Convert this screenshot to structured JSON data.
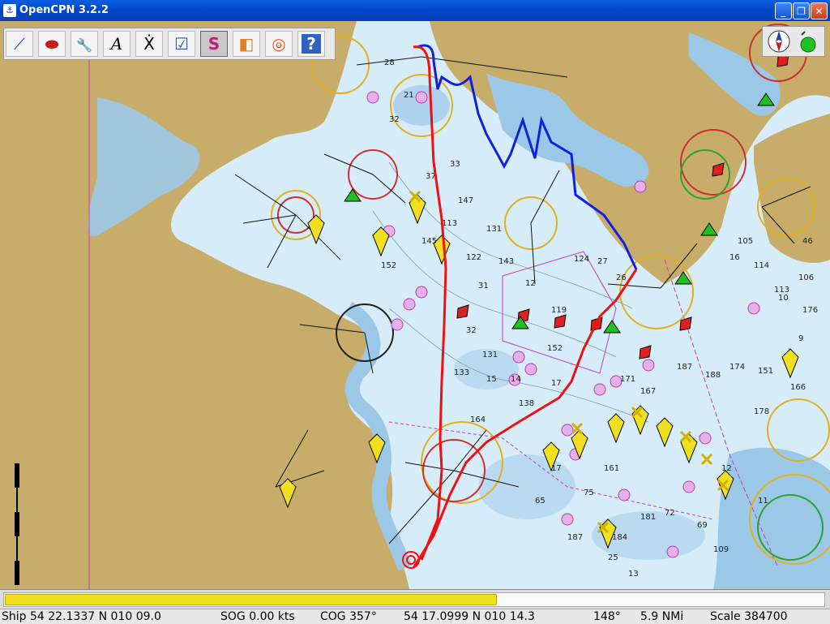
{
  "window": {
    "title": "OpenCPN 3.2.2",
    "minimize": "_",
    "maximize": "❐",
    "close": "✕"
  },
  "toolbar": {
    "tools": [
      {
        "name": "route",
        "icon": "route-icon",
        "glyph": "⟋"
      },
      {
        "name": "ship",
        "icon": "ship-icon",
        "glyph": "⬬"
      },
      {
        "name": "settings",
        "icon": "wrench-icon",
        "glyph": "🔧"
      },
      {
        "name": "text",
        "icon": "text-icon",
        "glyph": "A"
      },
      {
        "name": "hide-text",
        "icon": "hide-text-icon",
        "glyph": "Ẋ"
      },
      {
        "name": "route-manager",
        "icon": "route-manager-icon",
        "glyph": "☑"
      },
      {
        "name": "tracks",
        "icon": "track-icon",
        "glyph": "S"
      },
      {
        "name": "color-scheme",
        "icon": "sunset-icon",
        "glyph": "◧"
      },
      {
        "name": "mob",
        "icon": "lifebuoy-icon",
        "glyph": "◎"
      },
      {
        "name": "help",
        "icon": "help-icon",
        "glyph": "?"
      }
    ]
  },
  "status": {
    "ship": "Ship 54 22.1337 N   010 09.0",
    "sog": "SOG 0.00 kts",
    "cog": "COG 357°",
    "cursor": "54 17.0999 N   010 14.3",
    "bearing": "148°",
    "distance": "5.9 NMi",
    "scale": "Scale 384700"
  },
  "progress": {
    "value": 0.6
  },
  "chart_labels": {
    "depths": [
      "28",
      "21",
      "32",
      "37",
      "33",
      "147",
      "113",
      "131",
      "122",
      "31",
      "32",
      "143",
      "12",
      "124",
      "27",
      "26",
      "119",
      "152",
      "131",
      "133",
      "15",
      "14",
      "17",
      "171",
      "167",
      "187",
      "188",
      "174",
      "151",
      "166",
      "161",
      "181",
      "184",
      "187",
      "25",
      "13",
      "12",
      "11",
      "10",
      "9",
      "178",
      "176",
      "114",
      "113",
      "16",
      "46",
      "152",
      "145",
      "164",
      "138",
      "17",
      "75",
      "65",
      "69",
      "109",
      "105",
      "106",
      "72"
    ]
  },
  "colors": {
    "land": "#c8ac6a",
    "shallow": "#9cc8e8",
    "deep": "#d6ecf8",
    "track_red": "#ee1111",
    "track_blue": "#1020e0",
    "progress": "#f0e020"
  }
}
